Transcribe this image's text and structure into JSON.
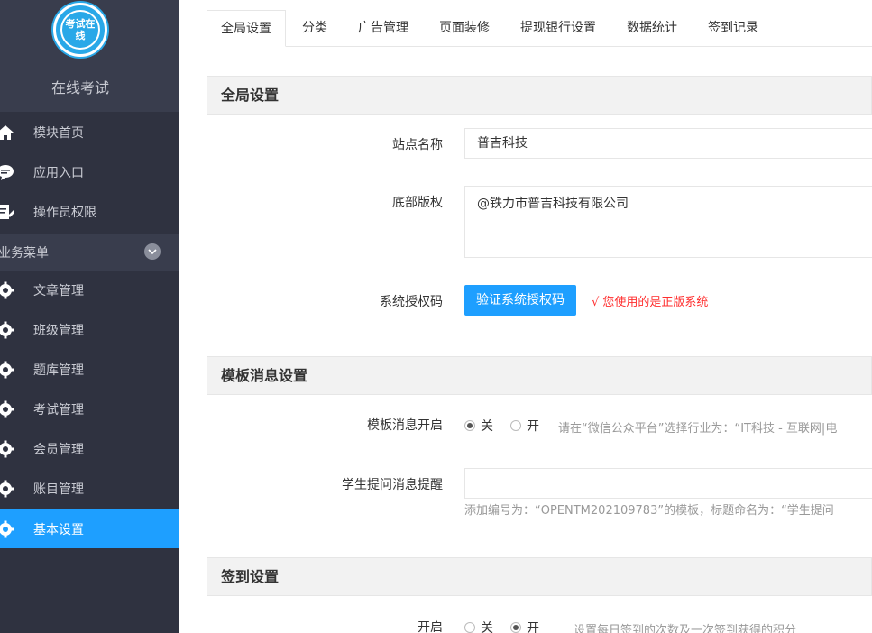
{
  "app": {
    "logo_text": "考试在线",
    "brand_name": "在线考试"
  },
  "sidebar": {
    "items": [
      {
        "label": "模块首页",
        "icon": "home-icon"
      },
      {
        "label": "应用入口",
        "icon": "chat-icon"
      },
      {
        "label": "操作员权限",
        "icon": "edit-icon"
      }
    ],
    "group": {
      "label": "业务菜单",
      "icon": "chevron-down-icon"
    },
    "group_items": [
      {
        "label": "文章管理",
        "icon": "gear-icon"
      },
      {
        "label": "班级管理",
        "icon": "gear-icon"
      },
      {
        "label": "题库管理",
        "icon": "gear-icon"
      },
      {
        "label": "考试管理",
        "icon": "gear-icon"
      },
      {
        "label": "会员管理",
        "icon": "gear-icon"
      },
      {
        "label": "账目管理",
        "icon": "gear-icon"
      },
      {
        "label": "基本设置",
        "icon": "gear-icon",
        "active": true
      }
    ]
  },
  "tabs": [
    {
      "label": "全局设置",
      "active": true
    },
    {
      "label": "分类"
    },
    {
      "label": "广告管理"
    },
    {
      "label": "页面装修"
    },
    {
      "label": "提现银行设置"
    },
    {
      "label": "数据统计"
    },
    {
      "label": "签到记录"
    }
  ],
  "global": {
    "title": "全局设置",
    "site_name_label": "站点名称",
    "site_name_value": "普吉科技",
    "copyright_label": "底部版权",
    "copyright_value": "@铁力市普吉科技有限公司",
    "license_label": "系统授权码",
    "license_button": "验证系统授权码",
    "license_status": "√ 您使用的是正版系统"
  },
  "template": {
    "title": "模板消息设置",
    "enable_label": "模板消息开启",
    "option_off": "关",
    "option_on": "开",
    "enable_selected": "关",
    "enable_hint": "请在“微信公众平台”选择行业为：“IT科技 - 互联网|电",
    "question_label": "学生提问消息提醒",
    "question_value": "",
    "question_hint": "添加编号为：“OPENTM202109783”的模板，标题命名为：“学生提问"
  },
  "checkin": {
    "title": "签到设置",
    "enable_label": "开启",
    "option_off": "关",
    "option_on": "开",
    "enable_selected": "开",
    "enable_hint": "设置每日签到的次数及一次签到获得的积分"
  },
  "colors": {
    "sidebar_bg": "#2f3240",
    "accent": "#1e9fff",
    "status_ok": "#ff2e2e"
  }
}
